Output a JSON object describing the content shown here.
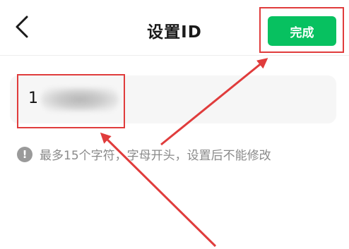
{
  "header": {
    "title": "设置ID",
    "done_label": "完成"
  },
  "id_input": {
    "visible_value": "1"
  },
  "hint": {
    "icon_glyph": "!",
    "text": "最多15个字符，字母开头，设置后不能修改"
  },
  "icons": {
    "back": "chevron-left-icon",
    "hint": "exclamation-circle-icon"
  },
  "colors": {
    "accent_green": "#07c160",
    "annotation_red": "#e03c3c",
    "hint_gray": "#8a8a8a"
  }
}
